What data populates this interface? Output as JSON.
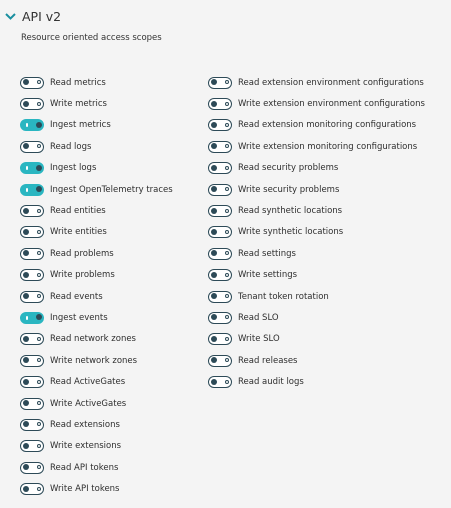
{
  "section": {
    "title": "API v2",
    "subtitle": "Resource oriented access scopes"
  },
  "colors": {
    "on": "#2ab6c1",
    "off_border": "#2d4a57"
  },
  "scopes_left": [
    {
      "label": "Read metrics",
      "enabled": false
    },
    {
      "label": "Write metrics",
      "enabled": false
    },
    {
      "label": "Ingest metrics",
      "enabled": true
    },
    {
      "label": "Read logs",
      "enabled": false
    },
    {
      "label": "Ingest logs",
      "enabled": true
    },
    {
      "label": "Ingest OpenTelemetry traces",
      "enabled": true
    },
    {
      "label": "Read entities",
      "enabled": false
    },
    {
      "label": "Write entities",
      "enabled": false
    },
    {
      "label": "Read problems",
      "enabled": false
    },
    {
      "label": "Write problems",
      "enabled": false
    },
    {
      "label": "Read events",
      "enabled": false
    },
    {
      "label": "Ingest events",
      "enabled": true
    },
    {
      "label": "Read network zones",
      "enabled": false
    },
    {
      "label": "Write network zones",
      "enabled": false
    },
    {
      "label": "Read ActiveGates",
      "enabled": false
    },
    {
      "label": "Write ActiveGates",
      "enabled": false
    },
    {
      "label": "Read extensions",
      "enabled": false
    },
    {
      "label": "Write extensions",
      "enabled": false
    },
    {
      "label": "Read API tokens",
      "enabled": false
    },
    {
      "label": "Write API tokens",
      "enabled": false
    }
  ],
  "scopes_right": [
    {
      "label": "Read extension environment configurations",
      "enabled": false
    },
    {
      "label": "Write extension environment configurations",
      "enabled": false
    },
    {
      "label": "Read extension monitoring configurations",
      "enabled": false
    },
    {
      "label": "Write extension monitoring configurations",
      "enabled": false
    },
    {
      "label": "Read security problems",
      "enabled": false
    },
    {
      "label": "Write security problems",
      "enabled": false
    },
    {
      "label": "Read synthetic locations",
      "enabled": false
    },
    {
      "label": "Write synthetic locations",
      "enabled": false
    },
    {
      "label": "Read settings",
      "enabled": false
    },
    {
      "label": "Write settings",
      "enabled": false
    },
    {
      "label": "Tenant token rotation",
      "enabled": false
    },
    {
      "label": "Read SLO",
      "enabled": false
    },
    {
      "label": "Write SLO",
      "enabled": false
    },
    {
      "label": "Read releases",
      "enabled": false
    },
    {
      "label": "Read audit logs",
      "enabled": false
    }
  ]
}
